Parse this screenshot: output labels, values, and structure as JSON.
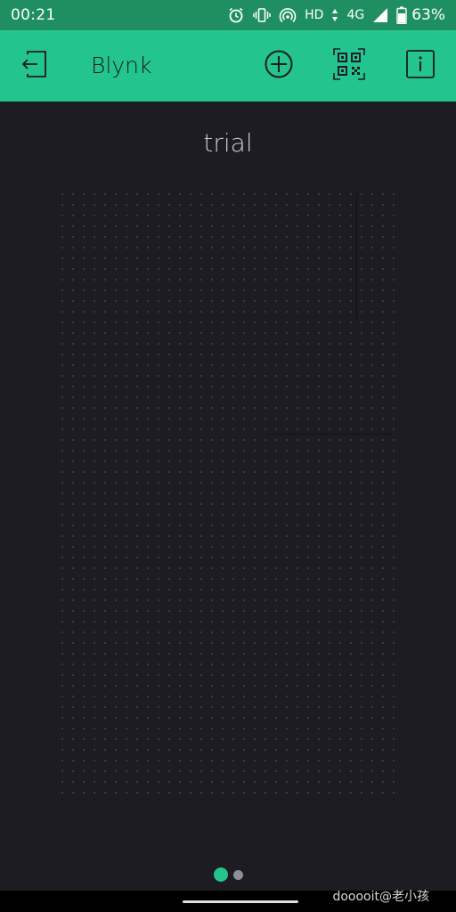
{
  "status_bar": {
    "time": "00:21",
    "network_label": "HD",
    "network_type": "4G",
    "battery_percent": "63%",
    "icons": [
      "alarm-icon",
      "vibrate-icon",
      "hotspot-icon",
      "signal-icon",
      "battery-icon"
    ]
  },
  "app_bar": {
    "title": "Blynk",
    "background_color": "#23c48e",
    "icons": [
      "logout-icon",
      "add-widget-icon",
      "qr-code-icon",
      "info-icon"
    ]
  },
  "dashboard": {
    "project_title": "trial",
    "background_color": "#1c1c22"
  },
  "pagination": {
    "pages": 2,
    "current_page": 1,
    "active_color": "#23c48e"
  },
  "watermark": "dooooit@老小孩"
}
